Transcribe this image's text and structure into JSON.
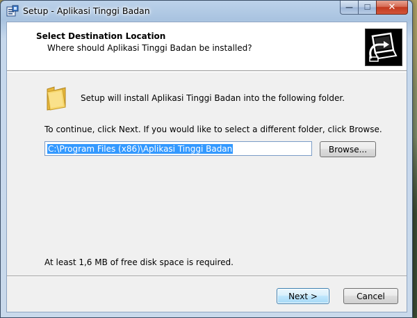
{
  "window": {
    "title": "Setup - Aplikasi Tinggi Badan",
    "caption_buttons": {
      "minimize": "—",
      "maximize": "☐",
      "close": "✕"
    }
  },
  "header": {
    "title": "Select Destination Location",
    "subtitle": "Where should Aplikasi Tinggi Badan be installed?"
  },
  "body": {
    "intro_text": "Setup will install Aplikasi Tinggi Badan into the following folder.",
    "continue_text": "To continue, click Next. If you would like to select a different folder, click Browse.",
    "destination_path": "C:\\Program Files (x86)\\Aplikasi Tinggi Badan",
    "browse_label": "Browse...",
    "disk_space_text": "At least 1,6 MB of free disk space is required."
  },
  "footer": {
    "next_label": "Next >",
    "cancel_label": "Cancel"
  },
  "icons": {
    "app": "setup-icon",
    "folder": "folder-icon",
    "wizard": "computer-install-icon"
  },
  "colors": {
    "selection": "#3399ff",
    "default_button_border": "#3c7fb1",
    "close_button": "#c2391f"
  }
}
